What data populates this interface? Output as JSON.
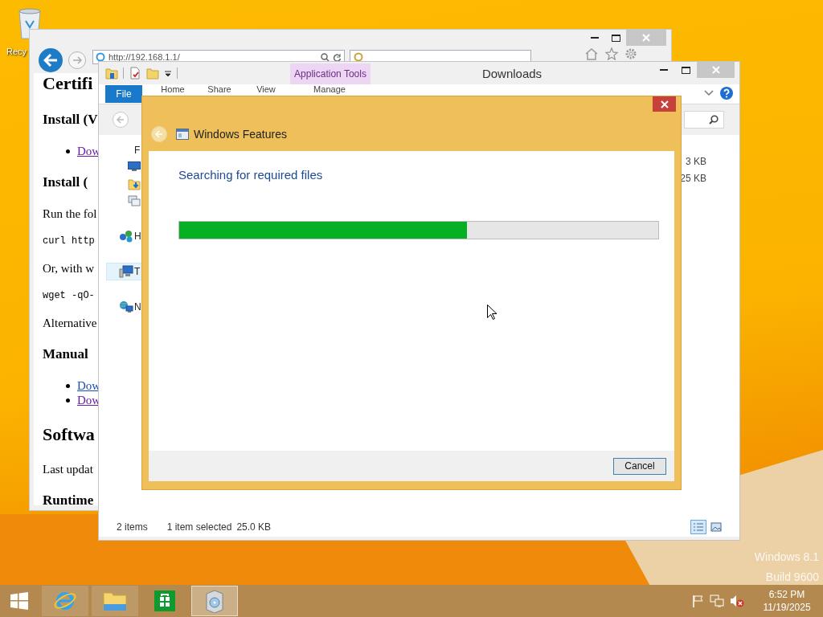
{
  "desktop": {
    "icons": [
      {
        "label": "Recy"
      }
    ],
    "watermark": [
      "Windows 8.1",
      "Build 9600"
    ]
  },
  "browser": {
    "address": "http://192.168.1.1/",
    "content": [
      {
        "kind": "h1",
        "text": "Certifi"
      },
      {
        "kind": "h2",
        "text": "Install (V"
      },
      {
        "kind": "li",
        "text": "Dow",
        "visited": true
      },
      {
        "kind": "h2",
        "text": "Install ("
      },
      {
        "kind": "p",
        "text": "Run the fol"
      },
      {
        "kind": "code",
        "text": "curl http"
      },
      {
        "kind": "p",
        "text": "Or, with w"
      },
      {
        "kind": "code",
        "text": "wget -qO-"
      },
      {
        "kind": "p",
        "text": "Alternative"
      },
      {
        "kind": "h2",
        "text": "Manual"
      },
      {
        "kind": "li",
        "text": "Dow",
        "visited": false
      },
      {
        "kind": "li",
        "text": "Dow",
        "visited": true
      },
      {
        "kind": "h1",
        "text": "Softwa"
      },
      {
        "kind": "p",
        "text": "Last updat"
      },
      {
        "kind": "h2",
        "text": "Runtime"
      }
    ]
  },
  "explorer": {
    "title": "Downloads",
    "contextual_tab": "Application Tools",
    "ribbon_tabs": [
      {
        "label": "File",
        "kind": "file"
      },
      {
        "label": "Home",
        "kind": "tab"
      },
      {
        "label": "Share",
        "kind": "tab"
      },
      {
        "label": "View",
        "kind": "tab"
      },
      {
        "label": "Manage",
        "kind": "contextual"
      }
    ],
    "nav_pane": [
      {
        "kind": "favorites",
        "label": "F",
        "selected": false,
        "children": [
          {
            "kind": "desktop",
            "selected": false
          },
          {
            "kind": "downloads",
            "selected": false
          },
          {
            "kind": "recent",
            "selected": false
          }
        ]
      },
      {
        "kind": "homegroup",
        "label": "H",
        "selected": false
      },
      {
        "kind": "computer",
        "label": "T",
        "selected": true
      },
      {
        "kind": "network",
        "label": "N",
        "selected": false
      }
    ],
    "file_sizes": [
      "3 KB",
      "25 KB"
    ],
    "status_bar": {
      "item_count": "2 items",
      "selection": "1 item selected",
      "selection_size": "25.0 KB"
    },
    "views": [
      {
        "kind": "details",
        "selected": true
      },
      {
        "kind": "large_icons",
        "selected": false
      }
    ]
  },
  "dialog": {
    "title": "Windows Features",
    "status": "Searching for required files",
    "progress": {
      "level": 0.6
    },
    "buttons": [
      {
        "label": "Cancel"
      }
    ]
  },
  "taskbar": {
    "items": [
      {
        "kind": "browser",
        "running": true,
        "selected": false
      },
      {
        "kind": "folder",
        "running": true,
        "selected": false
      },
      {
        "kind": "store",
        "running": false,
        "selected": false
      },
      {
        "kind": "package",
        "running": true,
        "selected": true
      }
    ],
    "clock": {
      "time": "6:52 PM",
      "date": "11/19/2025"
    }
  }
}
